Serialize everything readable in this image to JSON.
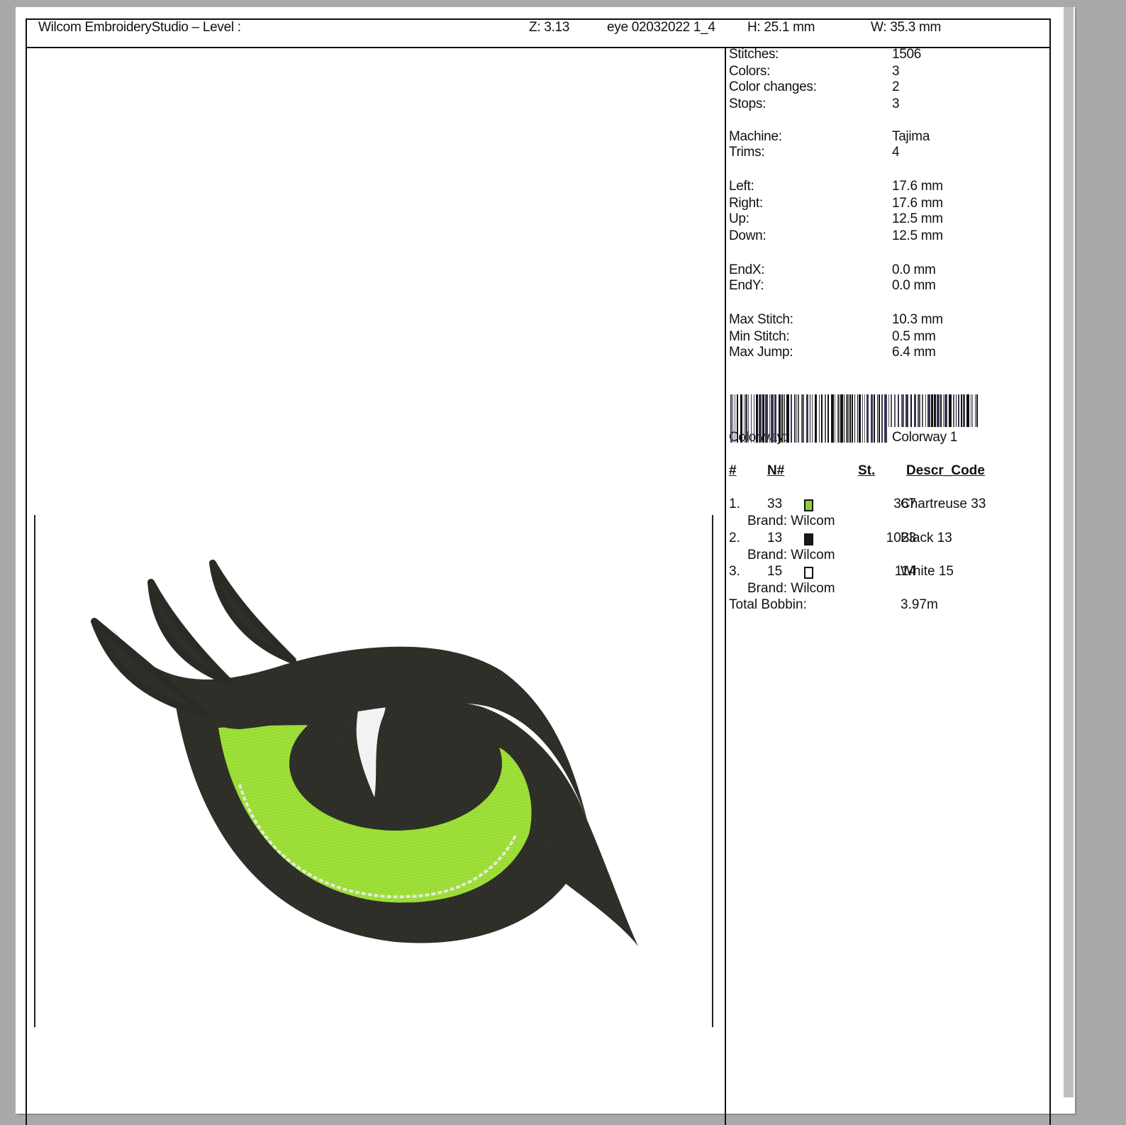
{
  "header": {
    "title": "Wilcom EmbroideryStudio – Level :",
    "zoom": "Z: 3.13",
    "file": "eye 02032022 1_4",
    "height": "H: 25.1 mm",
    "width": "W: 35.3 mm"
  },
  "stats": [
    {
      "label": "Stitches:",
      "value": "1506"
    },
    {
      "label": "Colors:",
      "value": "3"
    },
    {
      "label": "Color changes:",
      "value": "2"
    },
    {
      "label": "Stops:",
      "value": "3"
    },
    {
      "label": "Machine:",
      "value": "Tajima"
    },
    {
      "label": "Trims:",
      "value": "4"
    },
    {
      "label": "Left:",
      "value": "17.6 mm"
    },
    {
      "label": "Right:",
      "value": "17.6 mm"
    },
    {
      "label": "Up:",
      "value": "12.5 mm"
    },
    {
      "label": "Down:",
      "value": "12.5 mm"
    },
    {
      "label": "EndX:",
      "value": "0.0 mm"
    },
    {
      "label": "EndY:",
      "value": "0.0 mm"
    },
    {
      "label": "Max Stitch:",
      "value": "10.3 mm"
    },
    {
      "label": "Min Stitch:",
      "value": "0.5 mm"
    },
    {
      "label": "Max Jump:",
      "value": "6.4 mm"
    }
  ],
  "colorway": {
    "label": "Colorway:",
    "value": "Colorway 1"
  },
  "table": {
    "headers": {
      "num": "#",
      "n": "N#",
      "st": "St.",
      "code": "Descr_Code"
    },
    "rows": [
      {
        "idx": "1.",
        "n": "33",
        "color": "#8fd13a",
        "st": "367",
        "name": "Chartreuse 33",
        "brand": "Brand: Wilcom"
      },
      {
        "idx": "2.",
        "n": "13",
        "color": "#1a1a1a",
        "st": "1023",
        "name": "Black 13",
        "brand": "Brand: Wilcom"
      },
      {
        "idx": "3.",
        "n": "15",
        "color": "#ffffff",
        "st": "114",
        "name": "White 15",
        "brand": "Brand: Wilcom"
      }
    ]
  },
  "bobbin": {
    "label": "Total Bobbin:",
    "value": "3.97m"
  },
  "colors": {
    "background": "#a9a9a9",
    "eye_green": "#9fe03a",
    "eye_black": "#2b2b26",
    "highlight": "#f2f2f2"
  },
  "icons": {
    "barcode": "barcode-icon"
  }
}
